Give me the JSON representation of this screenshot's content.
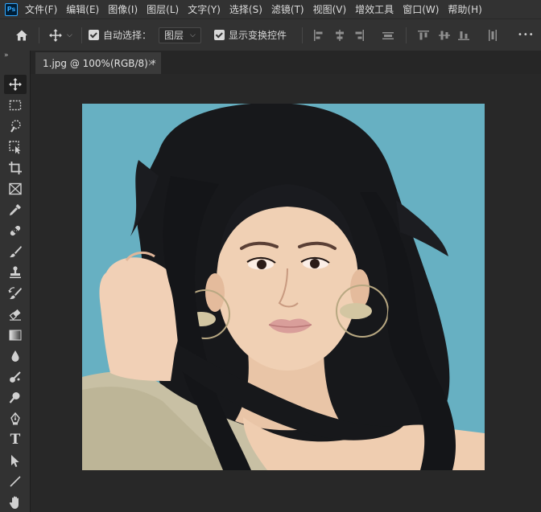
{
  "app": {
    "logo": "Ps"
  },
  "menu": {
    "items": [
      "文件(F)",
      "编辑(E)",
      "图像(I)",
      "图层(L)",
      "文字(Y)",
      "选择(S)",
      "滤镜(T)",
      "视图(V)",
      "增效工具",
      "窗口(W)",
      "帮助(H)"
    ]
  },
  "options": {
    "auto_select_label": "自动选择：",
    "auto_select_target": "图层",
    "show_transform_label": "显示变换控件",
    "more": "•••"
  },
  "toolbar": {
    "collapse": "»",
    "tools": [
      "move-tool",
      "marquee-tool",
      "lasso-tool",
      "object-select-tool",
      "crop-tool",
      "frame-tool",
      "eyedropper-tool",
      "healing-brush-tool",
      "brush-tool",
      "stamp-tool",
      "history-brush-tool",
      "eraser-tool",
      "gradient-tool",
      "blur-tool",
      "dodge-tool",
      "pen-tool",
      "type-tool",
      "path-select-tool",
      "line-tool",
      "hand-tool"
    ],
    "type_glyph": "T"
  },
  "document": {
    "tab_title": "1.jpg @ 100%(RGB/8) *",
    "close": "×"
  },
  "colors": {
    "canvas_bg": "#282828",
    "panel_bg": "#323232",
    "photo_bg": "#66b0c2"
  }
}
